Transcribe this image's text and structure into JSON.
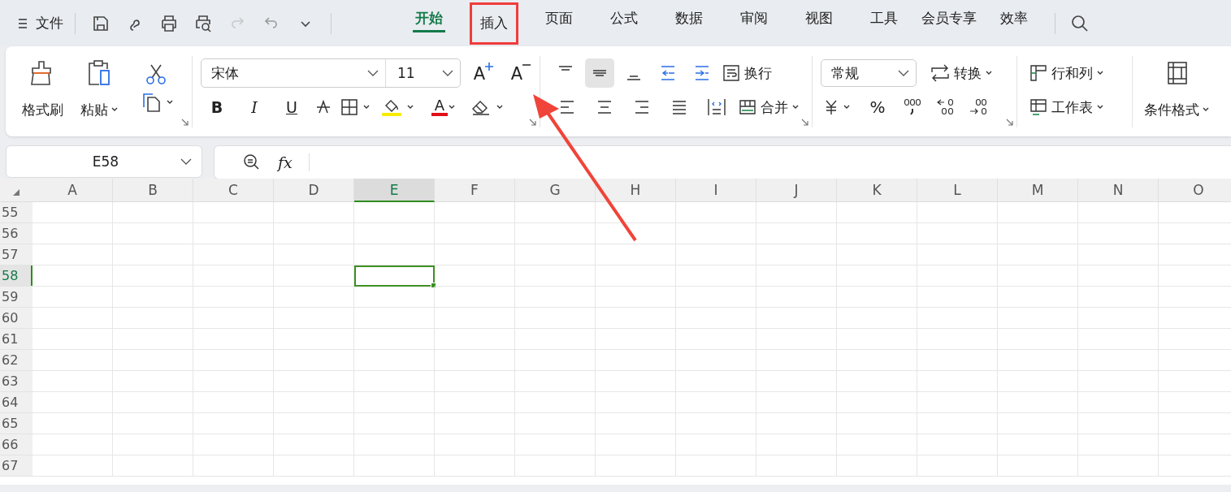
{
  "title_bar": {
    "file_menu": "文件",
    "tabs": [
      {
        "label": "开始",
        "selected": true,
        "highlighted": false
      },
      {
        "label": "插入",
        "selected": false,
        "highlighted": true
      },
      {
        "label": "页面",
        "selected": false,
        "highlighted": false
      },
      {
        "label": "公式",
        "selected": false,
        "highlighted": false
      },
      {
        "label": "数据",
        "selected": false,
        "highlighted": false
      },
      {
        "label": "审阅",
        "selected": false,
        "highlighted": false
      },
      {
        "label": "视图",
        "selected": false,
        "highlighted": false
      },
      {
        "label": "工具",
        "selected": false,
        "highlighted": false
      },
      {
        "label": "会员专享",
        "selected": false,
        "highlighted": false
      },
      {
        "label": "效率",
        "selected": false,
        "highlighted": false
      }
    ]
  },
  "ribbon": {
    "clipboard": {
      "format_painter": "格式刷",
      "paste": "粘贴"
    },
    "font": {
      "font_name": "宋体",
      "font_size": "11",
      "grow_font": "A",
      "shrink_font": "A",
      "bold": "B",
      "italic": "I",
      "underline": "U",
      "font_color": "A"
    },
    "alignment": {
      "wrap_text": "换行",
      "merge": "合并"
    },
    "number": {
      "format": "常规",
      "convert": "转换",
      "percent": "%"
    },
    "cells": {
      "rows_columns": "行和列",
      "worksheet": "工作表"
    },
    "styles": {
      "conditional_format": "条件格式"
    }
  },
  "formula_bar": {
    "name_box": "E58",
    "function_label": "fx"
  },
  "sheet": {
    "columns": [
      {
        "label": "A",
        "selected": false
      },
      {
        "label": "B",
        "selected": false
      },
      {
        "label": "C",
        "selected": false
      },
      {
        "label": "D",
        "selected": false
      },
      {
        "label": "E",
        "selected": true
      },
      {
        "label": "F",
        "selected": false
      },
      {
        "label": "G",
        "selected": false
      },
      {
        "label": "H",
        "selected": false
      },
      {
        "label": "I",
        "selected": false
      },
      {
        "label": "J",
        "selected": false
      },
      {
        "label": "K",
        "selected": false
      },
      {
        "label": "L",
        "selected": false
      },
      {
        "label": "M",
        "selected": false
      },
      {
        "label": "N",
        "selected": false
      },
      {
        "label": "O",
        "selected": false
      }
    ],
    "rows": [
      {
        "label": "55",
        "selected": false
      },
      {
        "label": "56",
        "selected": false
      },
      {
        "label": "57",
        "selected": false
      },
      {
        "label": "58",
        "selected": true
      },
      {
        "label": "59",
        "selected": false
      },
      {
        "label": "60",
        "selected": false
      },
      {
        "label": "61",
        "selected": false
      },
      {
        "label": "62",
        "selected": false
      },
      {
        "label": "63",
        "selected": false
      },
      {
        "label": "64",
        "selected": false
      },
      {
        "label": "65",
        "selected": false
      },
      {
        "label": "66",
        "selected": false
      },
      {
        "label": "67",
        "selected": false
      }
    ]
  }
}
